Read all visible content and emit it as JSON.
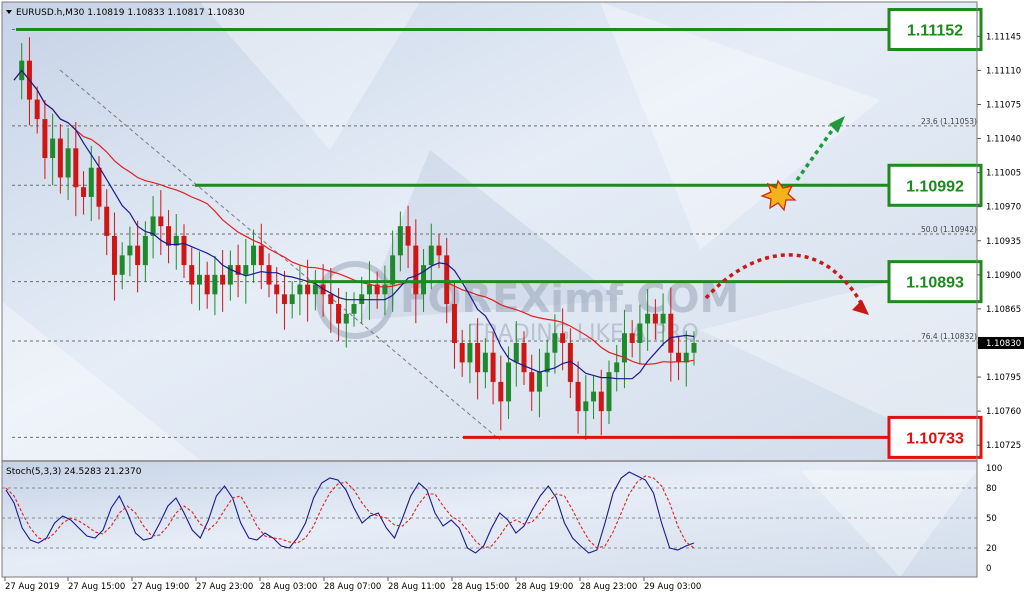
{
  "chart_data": [
    {
      "type": "candlestick",
      "title": "EURUSD.h,M30",
      "ohlc_header": "1.10819 1.10833 1.10817 1.10830",
      "ylim": [
        1.10718,
        1.1117
      ],
      "price_ticks": [
        "1.11145",
        "1.11110",
        "1.11075",
        "1.11040",
        "1.11005",
        "1.10970",
        "1.10935",
        "1.10900",
        "1.10865",
        "1.10830",
        "1.10795",
        "1.10760",
        "1.10725"
      ],
      "last_price": "1.10830",
      "time_labels": [
        "27 Aug 2019",
        "27 Aug 15:00",
        "27 Aug 19:00",
        "27 Aug 23:00",
        "28 Aug 03:00",
        "28 Aug 07:00",
        "28 Aug 11:00",
        "28 Aug 15:00",
        "28 Aug 19:00",
        "28 Aug 23:00",
        "29 Aug 03:00"
      ],
      "closes": [
        1.111,
        1.1112,
        1.1108,
        1.1106,
        1.1102,
        1.1104,
        1.11,
        1.1103,
        1.1099,
        1.1098,
        1.1101,
        1.1097,
        1.1094,
        1.109,
        1.1092,
        1.1093,
        1.1091,
        1.1094,
        1.1096,
        1.1095,
        1.1093,
        1.1094,
        1.1091,
        1.1089,
        1.109,
        1.1088,
        1.109,
        1.1089,
        1.1091,
        1.109,
        1.1091,
        1.1093,
        1.1091,
        1.1089,
        1.1088,
        1.1087,
        1.1088,
        1.1089,
        1.1088,
        1.1089,
        1.1088,
        1.1087,
        1.1085,
        1.1086,
        1.1087,
        1.1088,
        1.1089,
        1.1088,
        1.1089,
        1.1092,
        1.1095,
        1.1093,
        1.1088,
        1.1091,
        1.1093,
        1.1092,
        1.1087,
        1.1083,
        1.1081,
        1.1083,
        1.108,
        1.1082,
        1.1079,
        1.1077,
        1.1081,
        1.1083,
        1.108,
        1.1078,
        1.108,
        1.1082,
        1.1084,
        1.1083,
        1.1079,
        1.1076,
        1.1077,
        1.1078,
        1.1076,
        1.108,
        1.1081,
        1.1084,
        1.1083,
        1.1085,
        1.1086,
        1.1085,
        1.1086,
        1.1082,
        1.1081,
        1.1082,
        1.1083
      ],
      "levels": [
        {
          "label": "1.11152",
          "price": 1.11152,
          "color": "#1e8a1e"
        },
        {
          "label": "1.10992",
          "price": 1.10992,
          "color": "#1e8a1e"
        },
        {
          "label": "1.10893",
          "price": 1.10893,
          "color": "#1e8a1e"
        },
        {
          "label": "1.10733",
          "price": 1.10733,
          "color": "#e01010"
        }
      ],
      "fibo": [
        {
          "label": "23.6 (1.11053)",
          "price": 1.11053
        },
        {
          "label": "50.0 (1.10942)",
          "price": 1.10942
        },
        {
          "label": "76.4 (1.10832)",
          "price": 1.10832
        }
      ],
      "watermark": [
        "FOREXimf.COM",
        "TRADING LIKE A PRO"
      ],
      "colors": {
        "bull": "#1f8a2b",
        "bear": "#d01515",
        "ma_fast": "#1a1a8c",
        "ma_slow": "#e02020",
        "grid": "#8a8a8a"
      }
    },
    {
      "type": "line",
      "title": "Stoch(5,3,3) 24.5283 21.2370",
      "ylim": [
        0,
        100
      ],
      "levels": [
        "100",
        "80",
        "50",
        "20",
        "0"
      ],
      "series": [
        {
          "values": [
            78,
            65,
            40,
            28,
            25,
            30,
            45,
            52,
            48,
            40,
            32,
            30,
            38,
            60,
            72,
            55,
            35,
            28,
            30,
            45,
            62,
            70,
            55,
            38,
            30,
            48,
            72,
            82,
            70,
            45,
            30,
            28,
            35,
            30,
            22,
            20,
            30,
            45,
            70,
            85,
            90,
            88,
            78,
            60,
            45,
            52,
            55,
            40,
            30,
            50,
            72,
            85,
            78,
            55,
            42,
            48,
            40,
            20,
            15,
            22,
            40,
            55,
            48,
            35,
            42,
            58,
            72,
            82,
            70,
            45,
            30,
            22,
            15,
            18,
            45,
            75,
            90,
            96,
            92,
            88,
            75,
            45,
            20,
            18,
            22,
            25
          ]
        },
        {
          "values": [
            80,
            72,
            55,
            40,
            30,
            28,
            35,
            45,
            50,
            47,
            42,
            36,
            34,
            42,
            55,
            62,
            55,
            42,
            32,
            33,
            42,
            55,
            62,
            56,
            44,
            38,
            45,
            58,
            70,
            72,
            58,
            42,
            32,
            30,
            29,
            26,
            25,
            30,
            42,
            60,
            75,
            84,
            86,
            78,
            65,
            55,
            52,
            50,
            43,
            42,
            50,
            64,
            74,
            74,
            62,
            52,
            47,
            38,
            27,
            20,
            22,
            32,
            44,
            48,
            44,
            46,
            55,
            66,
            74,
            72,
            58,
            42,
            28,
            20,
            22,
            36,
            55,
            74,
            86,
            92,
            90,
            82,
            65,
            42,
            26,
            20
          ]
        }
      ],
      "colors": {
        "k": "#1a1a8c",
        "d": "#e02020"
      }
    }
  ]
}
